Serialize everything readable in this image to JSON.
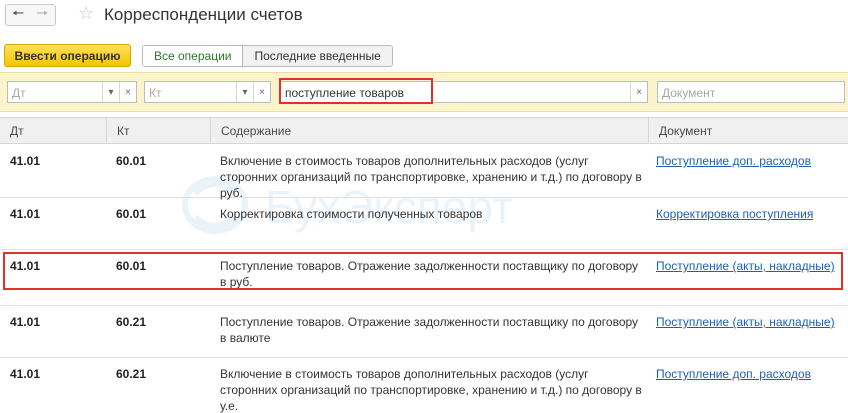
{
  "window": {
    "title": "Корреспонденции счетов"
  },
  "nav": {
    "back_icon": "arrow-left-icon",
    "forward_icon": "arrow-right-icon",
    "favorite_icon": "star-icon"
  },
  "toolbar": {
    "primary_label": "Ввести операцию",
    "filter_tabs": [
      {
        "label": "Все операции",
        "active": true
      },
      {
        "label": "Последние введенные",
        "active": false
      }
    ]
  },
  "filters": {
    "dt": {
      "placeholder": "Дт"
    },
    "kt": {
      "placeholder": "Кт"
    },
    "search": {
      "value": "поступление товаров"
    },
    "document": {
      "placeholder": "Документ"
    }
  },
  "table": {
    "columns": [
      "Дт",
      "Кт",
      "Содержание",
      "Документ"
    ],
    "rows": [
      {
        "dt": "41.01",
        "kt": "60.01",
        "content_lines": [
          "Включение в стоимость товаров дополнительных расходов (услуг",
          "сторонних организаций по транспортировке, хранению и т.д.) по договору в",
          "руб."
        ],
        "document": "Поступление доп. расходов"
      },
      {
        "dt": "41.01",
        "kt": "60.01",
        "content_lines": [
          "Корректировка стоимости полученных товаров"
        ],
        "document": "Корректировка поступления"
      },
      {
        "dt": "41.01",
        "kt": "60.01",
        "content_lines": [
          "Поступление товаров. Отражение задолженности поставщику по договору",
          "в руб."
        ],
        "document": "Поступление (акты, накладные)"
      },
      {
        "dt": "41.01",
        "kt": "60.21",
        "content_lines": [
          "Поступление товаров. Отражение задолженности поставщику по договору",
          "в валюте"
        ],
        "document": "Поступление (акты, накладные)"
      },
      {
        "dt": "41.01",
        "kt": "60.21",
        "content_lines": [
          "Включение в стоимость товаров дополнительных расходов (услуг",
          "сторонних организаций по транспортировке, хранению и т.д.) по договору в",
          "у.е."
        ],
        "document": "Поступление доп. расходов"
      }
    ]
  },
  "watermark": {
    "text": "БухЭксперт"
  },
  "colors": {
    "highlight": "#e0322b",
    "primary": "#f5c400",
    "link": "#1e5fb4",
    "filter_bg": "#fbf3c9"
  }
}
